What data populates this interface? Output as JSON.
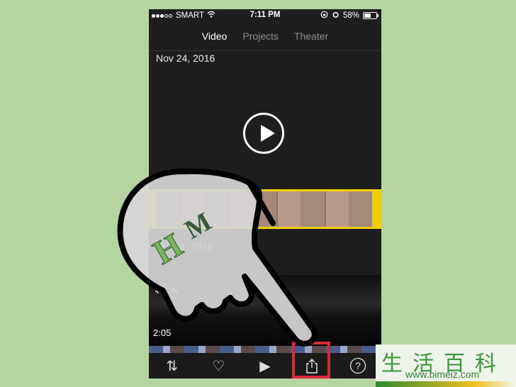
{
  "status_bar": {
    "signal_dots_filled": 3,
    "signal_dots_empty": 2,
    "carrier": "SMART",
    "time": "7:11 PM",
    "battery_percent": "58%",
    "battery_level": 0.58,
    "icons": [
      "wifi-icon",
      "rotation-lock-icon",
      "alarm-icon",
      "battery-icon"
    ]
  },
  "tabs": [
    {
      "label": "Video",
      "active": true
    },
    {
      "label": "Projects",
      "active": false
    },
    {
      "label": "Theater",
      "active": false
    }
  ],
  "sections": [
    {
      "date": "Nov 24, 2016",
      "clip_duration": "11s"
    },
    {
      "date": "Oct 24, 2016",
      "clip_duration": "6.3s",
      "total_duration": "2:05"
    }
  ],
  "toolbar": {
    "items": [
      {
        "name": "sort-button",
        "glyph": "⇅"
      },
      {
        "name": "favorite-button",
        "glyph": "♡"
      },
      {
        "name": "play-button",
        "glyph": "▶"
      },
      {
        "name": "share-button",
        "glyph": "share"
      },
      {
        "name": "help-button",
        "glyph": "?"
      }
    ]
  },
  "watermark": {
    "chinese": "生活百科",
    "url": "www.bimeiz.com"
  },
  "colors": {
    "background": "#b5d4a0",
    "clip_selection": "#f2d000",
    "highlight": "#d8283a"
  }
}
